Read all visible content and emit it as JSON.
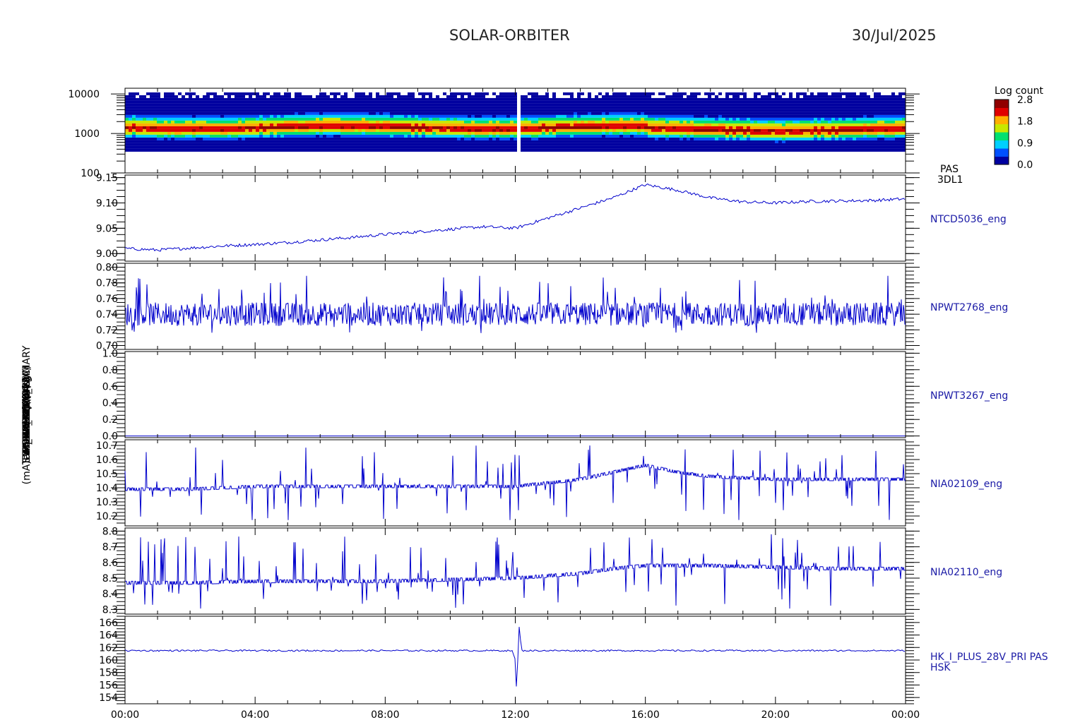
{
  "header": {
    "title": "SOLAR-ORBITER",
    "date": "30/Jul/2025"
  },
  "colors": {
    "trace": "#0000cc",
    "axis": "#000000",
    "label_text": "#000000",
    "panel_label": "#1a1aa6"
  },
  "x_axis": {
    "ticks": [
      "00:00",
      "04:00",
      "08:00",
      "12:00",
      "16:00",
      "20:00",
      "00:00"
    ]
  },
  "y_axis_label_overlay": [
    "(eV)",
    "Tempx Temp (DegC)",
    "SWA-EOBO PCM (A)",
    "SWA-TC1 (V)",
    "EAL21 (V)",
    "RPW TLM (mV)",
    "THERMAL 14 (V)",
    "FGM HK (Mons)",
    "(mA)DM_HK_IMON_PRIMARY"
  ],
  "chart_data": [
    {
      "type": "heatmap",
      "panel": "PAS 3DL1",
      "right_labels": [
        "PAS",
        "3DL1"
      ],
      "ylabel": "(eV)",
      "y_scale": "log",
      "y_ticks": [
        "10000",
        "1000",
        "100"
      ],
      "ylim": [
        100,
        14000
      ],
      "colorbar": {
        "title": "Log count",
        "ticks": [
          "2.8",
          "1.8",
          "0.9",
          "0.0"
        ],
        "range": [
          0.0,
          2.8
        ],
        "colors": [
          "#0000a0",
          "#0050ff",
          "#00d0ff",
          "#00e070",
          "#c8e800",
          "#ffb000",
          "#e00000",
          "#900000"
        ]
      },
      "peak_energy_ev": 1500,
      "band_low_ev": 350,
      "band_high_ev": 11000,
      "data_gap_time_h": 12.05
    },
    {
      "type": "line",
      "panel": "NTCD5036_eng",
      "right_labels": [
        "NTCD5036_eng"
      ],
      "y_ticks": [
        "9.15",
        "9.10",
        "9.05",
        "9.00"
      ],
      "ylim": [
        8.985,
        9.155
      ],
      "x": [
        0,
        1,
        2,
        3,
        4,
        5,
        6,
        7,
        8,
        9,
        10,
        11,
        12,
        13,
        14,
        15,
        16,
        17,
        18,
        19,
        20,
        21,
        22,
        23,
        24
      ],
      "values": [
        9.01,
        9.007,
        9.011,
        9.015,
        9.018,
        9.022,
        9.027,
        9.032,
        9.038,
        9.043,
        9.048,
        9.053,
        9.05,
        9.07,
        9.09,
        9.11,
        9.136,
        9.125,
        9.11,
        9.102,
        9.1,
        9.103,
        9.104,
        9.105,
        9.108
      ]
    },
    {
      "type": "line",
      "panel": "NPWT2768_eng",
      "right_labels": [
        "NPWT2768_eng"
      ],
      "y_ticks": [
        "0.80",
        "0.78",
        "0.76",
        "0.74",
        "0.72",
        "0.70"
      ],
      "ylim": [
        0.695,
        0.805
      ],
      "baseline": 0.74,
      "spread_low": 0.715,
      "spread_high": 0.79
    },
    {
      "type": "line",
      "panel": "NPWT3267_eng",
      "right_labels": [
        "NPWT3267_eng"
      ],
      "y_ticks": [
        "1.0",
        "0.8",
        "0.6",
        "0.4",
        "0.2",
        "0.0"
      ],
      "ylim": [
        -0.02,
        1.02
      ],
      "x": [
        0,
        24
      ],
      "values": [
        0.0,
        0.0
      ]
    },
    {
      "type": "line",
      "panel": "NIA02109_eng",
      "right_labels": [
        "NIA02109_eng"
      ],
      "y_ticks": [
        "10.7",
        "10.6",
        "10.5",
        "10.4",
        "10.3",
        "10.2"
      ],
      "ylim": [
        10.13,
        10.74
      ],
      "x": [
        0,
        2,
        4,
        6,
        8,
        10,
        12,
        14,
        15,
        16,
        17,
        18,
        20,
        22,
        24
      ],
      "values": [
        10.38,
        10.38,
        10.4,
        10.4,
        10.4,
        10.4,
        10.4,
        10.45,
        10.5,
        10.55,
        10.5,
        10.47,
        10.45,
        10.45,
        10.45
      ],
      "spread_low": 10.17,
      "spread_high": 10.7
    },
    {
      "type": "line",
      "panel": "NIA02110_eng",
      "right_labels": [
        "NIA02110_eng"
      ],
      "y_ticks": [
        "8.8",
        "8.7",
        "8.6",
        "8.5",
        "8.4",
        "8.3"
      ],
      "ylim": [
        8.27,
        8.82
      ],
      "x": [
        0,
        2,
        4,
        6,
        8,
        10,
        12,
        14,
        15,
        16,
        18,
        20,
        22,
        24
      ],
      "values": [
        8.46,
        8.46,
        8.47,
        8.47,
        8.47,
        8.48,
        8.49,
        8.52,
        8.55,
        8.57,
        8.57,
        8.56,
        8.55,
        8.55
      ],
      "spread_low": 8.3,
      "spread_high": 8.78
    },
    {
      "type": "line",
      "panel": "HK_I_PLUS_28V_PRI PAS HSK",
      "right_labels": [
        "HK_I_PLUS_28V_PRI PAS",
        "HSK"
      ],
      "y_ticks": [
        "166",
        "164",
        "162",
        "160",
        "158",
        "156",
        "154"
      ],
      "ylim": [
        153,
        167
      ],
      "baseline": 161.5,
      "x": [
        0,
        11.9,
        12.0,
        12.05,
        12.1,
        12.2,
        24
      ],
      "values": [
        161.5,
        161.5,
        160.0,
        153.4,
        166.1,
        161.5,
        161.5
      ]
    }
  ]
}
